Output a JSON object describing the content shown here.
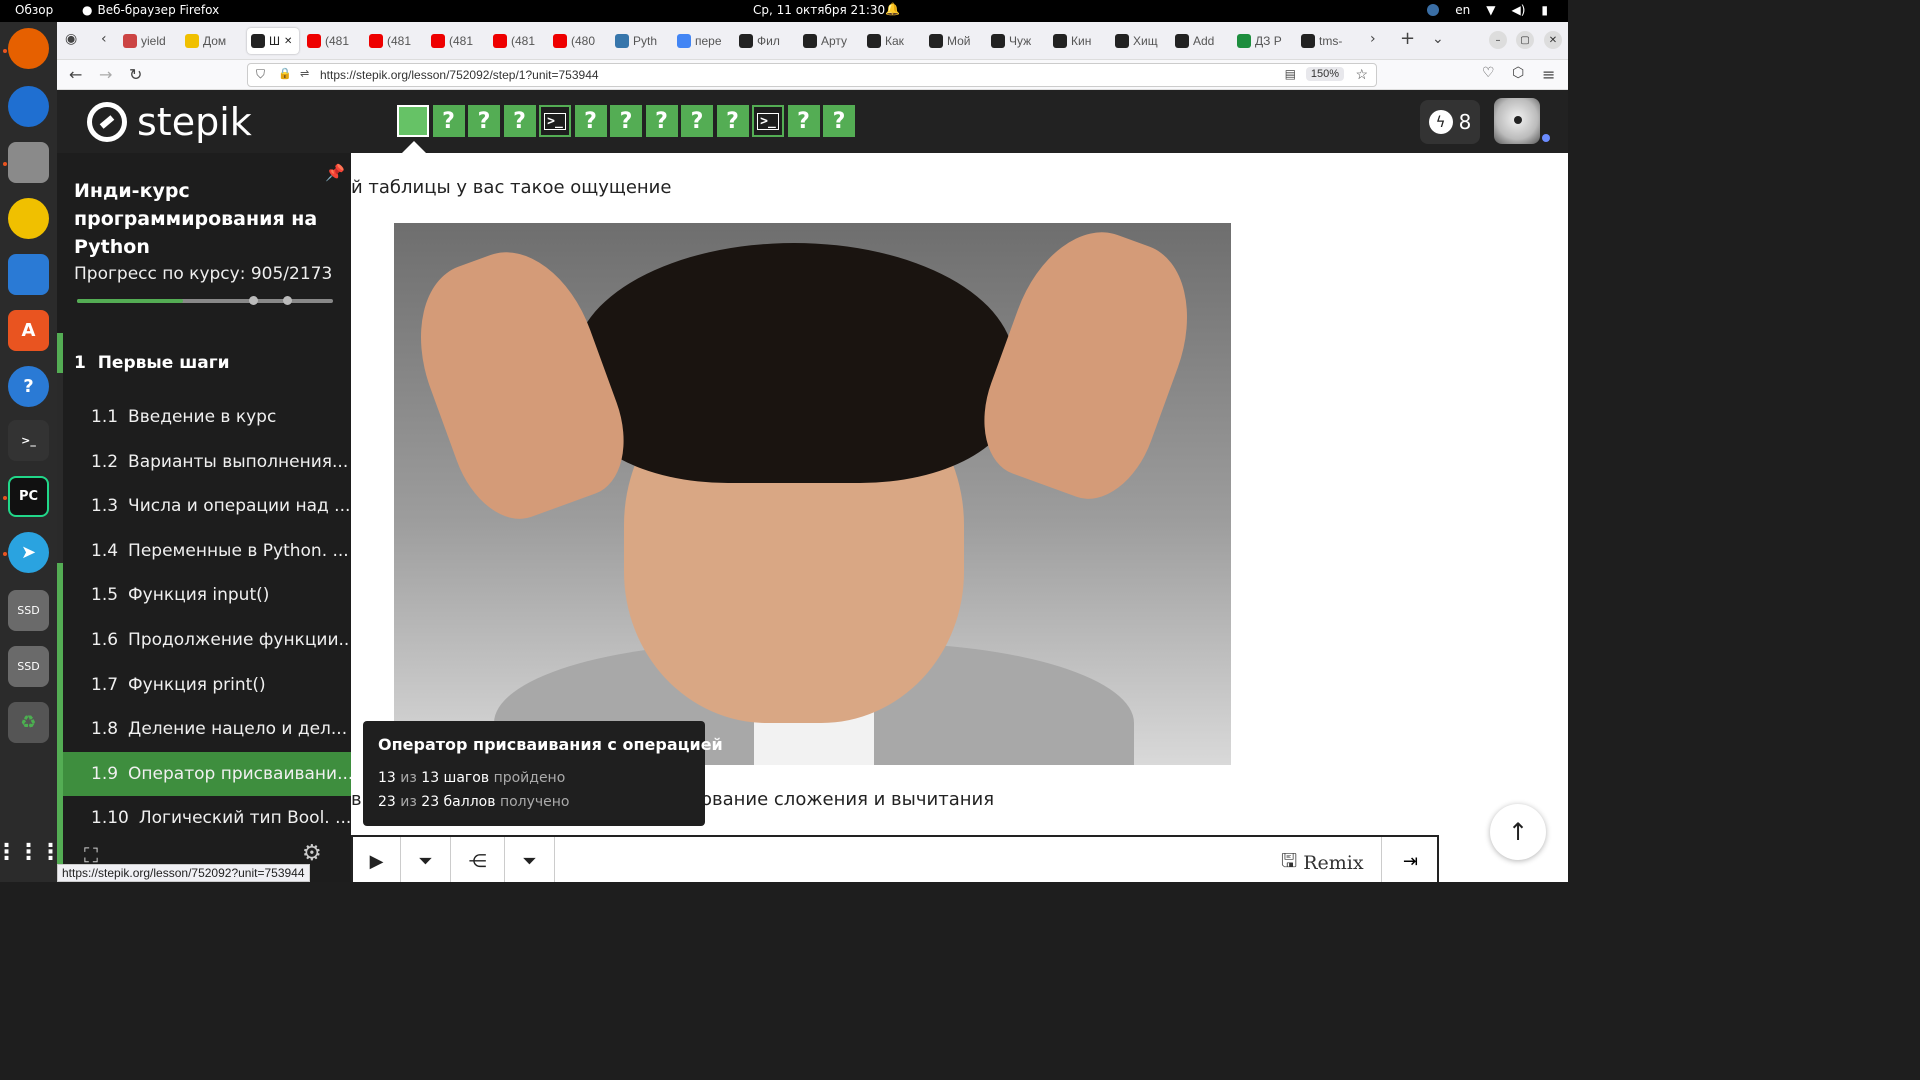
{
  "system": {
    "overview_label": "Обзор",
    "app_label": "Веб-браузер Firefox",
    "clock": "Ср, 11 октября  21:30",
    "lang": "en"
  },
  "dock": {
    "items": [
      "firefox-icon",
      "thunderbird-icon",
      "files-icon",
      "rhythmbox-icon",
      "writer-icon",
      "app-center-icon",
      "help-icon",
      "terminal-icon",
      "pycharm-icon",
      "telegram-icon",
      "ssd-drive-icon",
      "ssd-drive-icon",
      "trash-icon",
      "apps-grid-icon"
    ],
    "ssd_label": "SSD"
  },
  "tabs": [
    {
      "label": "yield"
    },
    {
      "label": "Дом"
    },
    {
      "label": "Ш"
    },
    {
      "label": "(481"
    },
    {
      "label": "(481"
    },
    {
      "label": "(481"
    },
    {
      "label": "(481"
    },
    {
      "label": "(480"
    },
    {
      "label": "Pyth"
    },
    {
      "label": "пере"
    },
    {
      "label": "Фил"
    },
    {
      "label": "Арту"
    },
    {
      "label": "Как"
    },
    {
      "label": "Мой"
    },
    {
      "label": "Чуж"
    },
    {
      "label": "Кин"
    },
    {
      "label": "Хищ"
    },
    {
      "label": "Add"
    },
    {
      "label": "ДЗ Р"
    },
    {
      "label": "tms-"
    }
  ],
  "navbar": {
    "url": "https://stepik.org/lesson/752092/step/1?unit=753944",
    "zoom": "150%"
  },
  "header": {
    "logo_text": "stepik",
    "steps": [
      {
        "kind": "done",
        "label": ""
      },
      {
        "kind": "quiz",
        "label": "?"
      },
      {
        "kind": "quiz",
        "label": "?"
      },
      {
        "kind": "quiz",
        "label": "?"
      },
      {
        "kind": "code",
        "label": ">_"
      },
      {
        "kind": "quiz",
        "label": "?"
      },
      {
        "kind": "quiz",
        "label": "?"
      },
      {
        "kind": "quiz",
        "label": "?"
      },
      {
        "kind": "quiz",
        "label": "?"
      },
      {
        "kind": "quiz",
        "label": "?"
      },
      {
        "kind": "code",
        "label": ">_"
      },
      {
        "kind": "quiz",
        "label": "?"
      },
      {
        "kind": "quiz",
        "label": "?"
      }
    ],
    "energy_count": "8"
  },
  "sidebar": {
    "course_title": "Инди-курс программирования на Python",
    "progress_label": "Прогресс по курсу:  905/2173",
    "progress_fraction": 0.416,
    "module": {
      "number": "1",
      "title": "Первые шаги"
    },
    "lessons": [
      {
        "num": "1.1",
        "title": "Введение в курс"
      },
      {
        "num": "1.2",
        "title": "Варианты выполнения..."
      },
      {
        "num": "1.3",
        "title": "Числа и операции над ..."
      },
      {
        "num": "1.4",
        "title": "Переменные в Python. ..."
      },
      {
        "num": "1.5",
        "title": "Функция input()"
      },
      {
        "num": "1.6",
        "title": "Продолжение функции..."
      },
      {
        "num": "1.7",
        "title": "Функция print()"
      },
      {
        "num": "1.8",
        "title": "Деление нацело и дел..."
      },
      {
        "num": "1.9",
        "title": "Оператор присваивани..."
      },
      {
        "num": "1.10",
        "title": "Логический тип Bool. ..."
      }
    ]
  },
  "content": {
    "text_top": "й таблицы у вас такое ощущение",
    "text_bottom_a": "в",
    "text_bottom_b": "ование сложения и вычитания",
    "remix_label": "Remix"
  },
  "tooltip": {
    "title": "Оператор присваивания с операцией",
    "steps_done": "13",
    "steps_of": "из",
    "steps_total": "13 шагов",
    "steps_status": "пройдено",
    "points_done": "23",
    "points_of": "из",
    "points_total": "23 баллов",
    "points_status": "получено"
  },
  "status_url": "https://stepik.org/lesson/752092?unit=753944"
}
